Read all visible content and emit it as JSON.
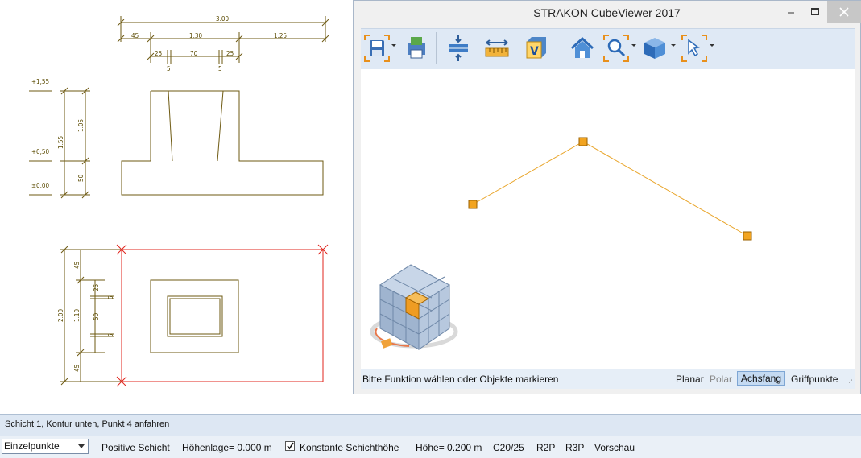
{
  "drawing": {
    "dims_top": [
      "3.00",
      "45",
      "1.30",
      "1.25",
      "25",
      "70",
      "25",
      "5",
      "5"
    ],
    "elevations": [
      "+1,55",
      "+0,50",
      "±0,00"
    ],
    "dims_left_section": [
      "1.55",
      "1.05",
      "50"
    ],
    "dims_left_plan": [
      "2.00",
      "45",
      "1.10",
      "45",
      "25",
      "50",
      "5",
      "5"
    ]
  },
  "viewer": {
    "title": "STRAKON CubeViewer 2017",
    "toolbar": {
      "save": "save-icon",
      "print": "print-icon",
      "section": "section-icon",
      "measure": "measure-icon",
      "view": "view-cube-icon",
      "home": "home-icon",
      "zoom": "zoom-icon",
      "render": "render-cube-icon",
      "select": "select-arrow-icon"
    },
    "status_hint": "Bitte Funktion wählen oder Objekte markieren",
    "status_items": [
      "Planar",
      "Polar",
      "Achsfang",
      "Griffpunkte"
    ]
  },
  "bottom": {
    "message": "Schicht 1, Kontur unten, Punkt 4 anfahren",
    "mode": "Einzelpunkte",
    "positive": "Positive Schicht",
    "hoehenlage": "Höhenlage= 0.000 m",
    "konstante": "Konstante Schichthöhe",
    "hoehe": "Höhe= 0.200 m",
    "concrete": "C20/25",
    "r2p": "R2P",
    "r3p": "R3P",
    "preview": "Vorschau"
  },
  "colors": {
    "drawing_line": "#7a5c00",
    "accent": "#e89a1c",
    "red": "#e0241c"
  }
}
